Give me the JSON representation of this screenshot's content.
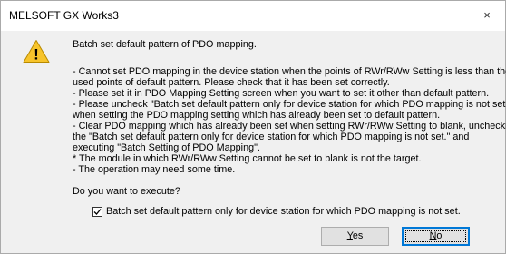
{
  "window": {
    "title": "MELSOFT GX Works3",
    "close_glyph": "×"
  },
  "icon": {
    "name": "warning-icon",
    "color": "#f7c42b",
    "glyph": "!"
  },
  "message": {
    "heading": "Batch set default pattern of PDO mapping.",
    "lines": [
      "- Cannot set PDO mapping in the device station when the points of RWr/RWw Setting is less than the",
      "used points of default pattern. Please check that it has been set correctly.",
      "- Please set it in PDO Mapping Setting screen when you want to set it other than default pattern.",
      "- Please uncheck \"Batch set default pattern only for device station for which PDO mapping is not set.\"",
      "when setting the PDO mapping setting which has already been set to default pattern.",
      "- Clear PDO mapping which has already been set when setting RWr/RWw Setting to blank, unchecking",
      "the \"Batch set default pattern only for device station for which PDO mapping is not set.\" and",
      "executing \"Batch Setting of PDO Mapping\".",
      "* The module in which RWr/RWw Setting cannot be set to blank is not the target.",
      "- The operation may need some time."
    ],
    "question": "Do you want to execute?"
  },
  "checkbox": {
    "label": "Batch set default pattern only for device station for which PDO mapping is not set.",
    "checked": true
  },
  "buttons": {
    "yes_mnemonic": "Y",
    "yes_rest": "es",
    "no_mnemonic": "N",
    "no_rest": "o"
  }
}
